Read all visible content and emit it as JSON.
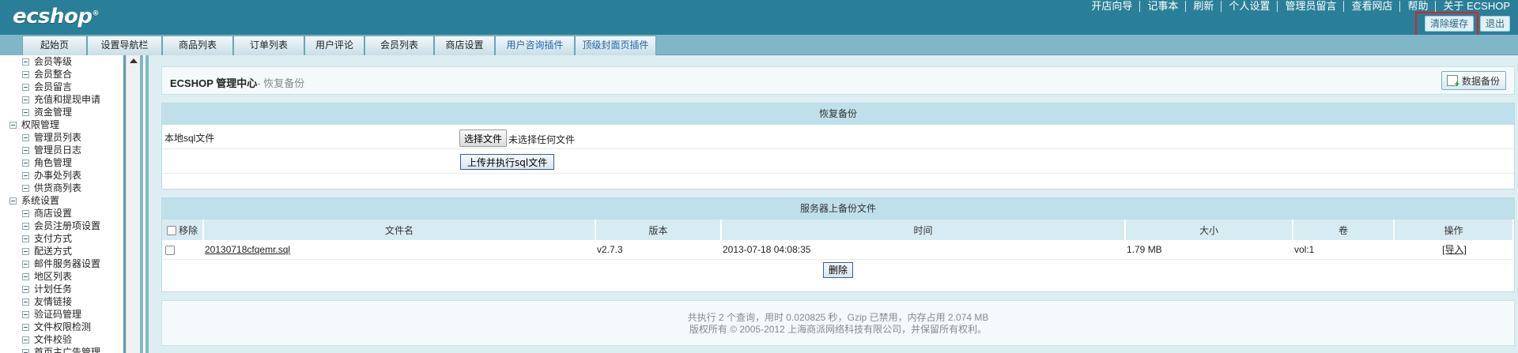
{
  "header": {
    "logo_text": "ecshop",
    "logo_mark": "®",
    "top_links": [
      "开店向导",
      "记事本",
      "刷新",
      "个人设置",
      "管理员留言",
      "查看网店",
      "帮助",
      "关于 ECSHOP"
    ],
    "clear_cache_label": "清除缓存",
    "logout_label": "退出"
  },
  "menu": {
    "tabs": [
      {
        "label": "起始页",
        "plugin": false
      },
      {
        "label": "设置导航栏",
        "plugin": false
      },
      {
        "label": "商品列表",
        "plugin": false
      },
      {
        "label": "订单列表",
        "plugin": false
      },
      {
        "label": "用户评论",
        "plugin": false
      },
      {
        "label": "会员列表",
        "plugin": false
      },
      {
        "label": "商店设置",
        "plugin": false
      },
      {
        "label": "用户咨询插件",
        "plugin": true
      },
      {
        "label": "顶级封面页插件",
        "plugin": true
      }
    ]
  },
  "sidebar": {
    "items": [
      {
        "label": "会员等级",
        "type": "child"
      },
      {
        "label": "会员整合",
        "type": "child"
      },
      {
        "label": "会员留言",
        "type": "child"
      },
      {
        "label": "充值和提现申请",
        "type": "child"
      },
      {
        "label": "资金管理",
        "type": "child"
      },
      {
        "label": "权限管理",
        "type": "group"
      },
      {
        "label": "管理员列表",
        "type": "child"
      },
      {
        "label": "管理员日志",
        "type": "child"
      },
      {
        "label": "角色管理",
        "type": "child"
      },
      {
        "label": "办事处列表",
        "type": "child"
      },
      {
        "label": "供货商列表",
        "type": "child"
      },
      {
        "label": "系统设置",
        "type": "group"
      },
      {
        "label": "商店设置",
        "type": "child"
      },
      {
        "label": "会员注册项设置",
        "type": "child"
      },
      {
        "label": "支付方式",
        "type": "child"
      },
      {
        "label": "配送方式",
        "type": "child"
      },
      {
        "label": "邮件服务器设置",
        "type": "child"
      },
      {
        "label": "地区列表",
        "type": "child"
      },
      {
        "label": "计划任务",
        "type": "child"
      },
      {
        "label": "友情链接",
        "type": "child"
      },
      {
        "label": "验证码管理",
        "type": "child"
      },
      {
        "label": "文件权限检测",
        "type": "child"
      },
      {
        "label": "文件校验",
        "type": "child"
      },
      {
        "label": "首页主广告管理",
        "type": "child"
      }
    ]
  },
  "page": {
    "title_main": "ECSHOP 管理中心",
    "title_sub": "- 恢复备份",
    "backup_button": "数据备份"
  },
  "restore": {
    "heading": "恢复备份",
    "local_label": "本地sql文件",
    "choose_button": "选择文件",
    "no_file_text": "未选择任何文件",
    "upload_button": "上传并执行sql文件"
  },
  "server": {
    "heading": "服务器上备份文件",
    "columns": [
      "移除",
      "文件名",
      "版本",
      "时间",
      "大小",
      "卷",
      "操作"
    ],
    "rows": [
      {
        "file": "20130718cfqemr.sql",
        "version": "v2.7.3",
        "time": "2013-07-18 04:08:35",
        "size": "1.79 MB",
        "vol": "vol:1",
        "action": "[导入]"
      }
    ],
    "delete_button": "删除"
  },
  "footer": {
    "line1": "共执行 2 个查询，用时 0.020825 秒，Gzip 已禁用，内存占用 2.074 MB",
    "line2": "版权所有 © 2005-2012 上海商派网络科技有限公司，并保留所有权利。"
  }
}
